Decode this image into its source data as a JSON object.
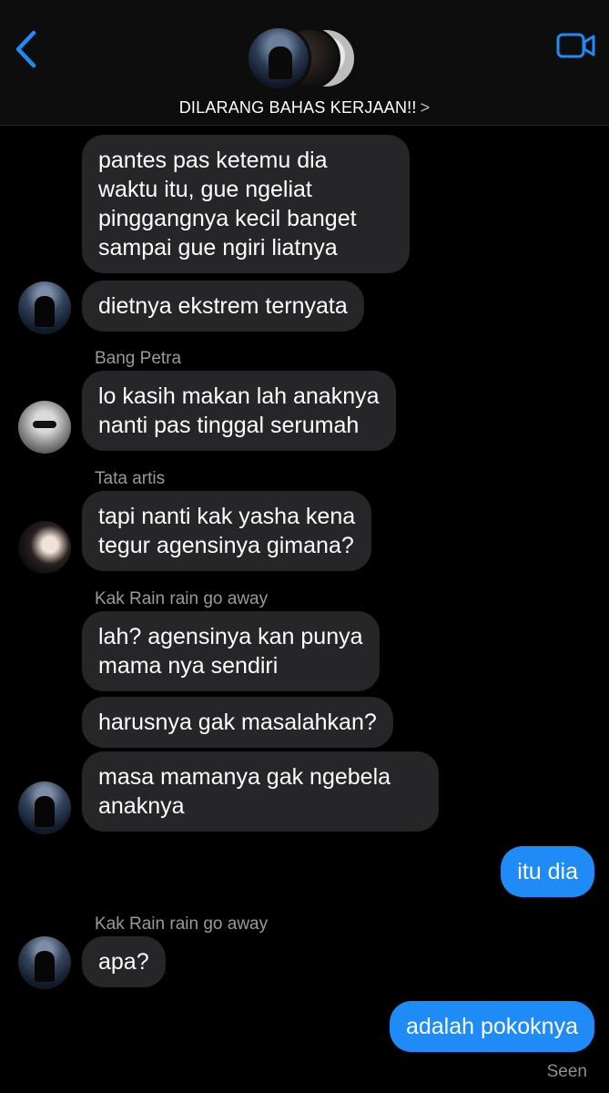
{
  "header": {
    "group_name": "DILARANG BAHAS KERJAAN!!",
    "chevron": ">",
    "back_icon": "chevron-left-icon",
    "video_icon": "video-camera-icon"
  },
  "messages": [
    {
      "text": "pantes pas ketemu dia\nwaktu itu, gue ngeliat\npinggangnya kecil banget\nsampai gue ngiri liatnya"
    },
    {
      "text": "dietnya ekstrem ternyata"
    },
    {
      "sender": "Bang Petra",
      "text": "lo kasih makan lah anaknya\nnanti pas tinggal serumah"
    },
    {
      "sender": "Tata artis",
      "text": "tapi nanti kak yasha kena\ntegur agensinya gimana?"
    },
    {
      "sender": "Kak Rain rain go away",
      "text": "lah? agensinya kan punya\nmama nya sendiri"
    },
    {
      "text": "harusnya gak masalahkan?"
    },
    {
      "text": "masa mamanya gak ngebela\nanaknya"
    },
    {
      "text": "itu dia",
      "from_me": true
    },
    {
      "sender": "Kak Rain rain go away",
      "text": "apa?"
    },
    {
      "text": "adalah pokoknya",
      "from_me": true
    }
  ],
  "status": {
    "seen": "Seen"
  },
  "colors": {
    "accent": "#1e8bf6",
    "bubble_incoming": "#262628",
    "background": "#000000"
  }
}
